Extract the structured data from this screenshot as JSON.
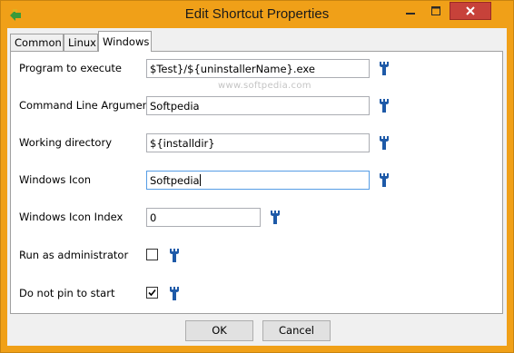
{
  "window": {
    "title": "Edit Shortcut Properties",
    "accent_color": "#f0a018",
    "close_color": "#c7423a"
  },
  "tabs": [
    {
      "label": "Common",
      "active": false
    },
    {
      "label": "Linux",
      "active": false
    },
    {
      "label": "Windows",
      "active": true
    }
  ],
  "watermark": "www.softpedia.com",
  "fields": {
    "program": {
      "label": "Program to execute",
      "value": "$Test}/${uninstallerName}.exe",
      "icon": "wrench-icon"
    },
    "args": {
      "label": "Command Line Argument",
      "value": "Softpedia",
      "icon": "wrench-icon"
    },
    "workdir": {
      "label": "Working directory",
      "value": "${installdir}",
      "icon": "wrench-icon"
    },
    "icon": {
      "label": "Windows Icon",
      "value": "Softpedia",
      "icon": "wrench-icon"
    },
    "icon_index": {
      "label": "Windows Icon Index",
      "value": "0",
      "icon": "wrench-icon"
    },
    "run_admin": {
      "label": "Run as administrator",
      "checked": false,
      "icon": "wrench-icon"
    },
    "no_pin": {
      "label": "Do not pin to start",
      "checked": true,
      "icon": "wrench-icon"
    }
  },
  "buttons": {
    "ok": "OK",
    "cancel": "Cancel"
  }
}
